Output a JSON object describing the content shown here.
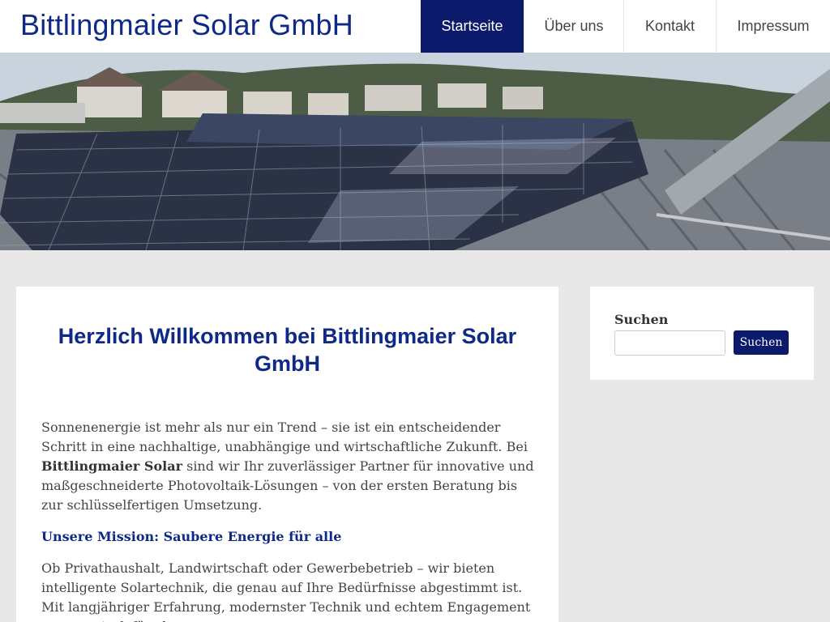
{
  "site": {
    "title": "Bittlingmaier Solar GmbH"
  },
  "nav": {
    "items": [
      {
        "label": "Startseite",
        "active": true
      },
      {
        "label": "Über uns",
        "active": false
      },
      {
        "label": "Kontakt",
        "active": false
      },
      {
        "label": "Impressum",
        "active": false
      }
    ]
  },
  "hero": {
    "image": "solar-panels-on-roof-photo"
  },
  "main": {
    "title": "Herzlich Willkommen bei Bittlingmaier Solar GmbH",
    "intro_before": "Sonnenenergie ist mehr als nur ein Trend – sie ist ein entscheidender Schritt in eine nachhaltige, unabhängige und wirtschaftliche Zukunft. Bei ",
    "intro_bold": "Bittlingmaier Solar",
    "intro_after": " sind wir Ihr zuverlässiger Partner für innovative und maßgeschneiderte Photovoltaik-Lösungen – von der ersten Beratung bis zur schlüsselfertigen Umsetzung.",
    "mission_heading": "Unsere Mission: Saubere Energie für alle",
    "mission_text": "Ob Privathaushalt, Landwirtschaft oder Gewerbebetrieb – wir bieten intelligente Solartechnik, die genau auf Ihre Bedürfnisse abgestimmt ist. Mit langjähriger Erfahrung, modernster Technik und echtem Engagement sorgen wir dafür, dass"
  },
  "sidebar": {
    "search_label": "Suchen",
    "search_value": "",
    "search_button": "Suchen"
  },
  "colors": {
    "brand": "#0f2a86",
    "nav_active": "#0c1a6b",
    "background": "#e8e8e8"
  }
}
